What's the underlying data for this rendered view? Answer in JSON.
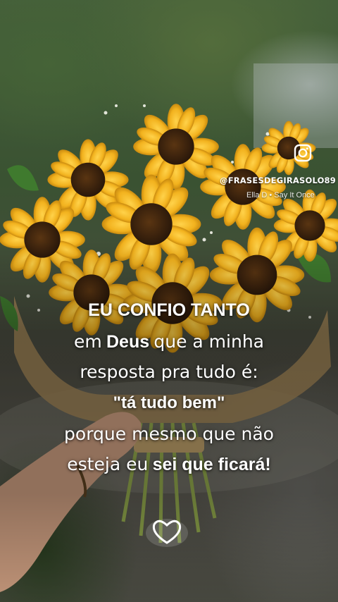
{
  "overlay": {
    "handle": "@FRASESDEGIRASOLO89",
    "music": "Ella D • Say It Once",
    "icon": "instagram-icon"
  },
  "caption": {
    "line1": "EU CONFIO TANTO",
    "line2_a": "em",
    "line2_b": "Deus",
    "line2_c": "que a minha",
    "line3": "resposta pra tudo é:",
    "line4": "\"tá tudo bem\"",
    "line5": "porque mesmo que não",
    "line6_a": "esteja eu",
    "line6_b": "sei que ficará!"
  },
  "colors": {
    "sunflower_petal": "#f2b21e",
    "sunflower_center": "#3a2410",
    "text": "#ffffff"
  }
}
